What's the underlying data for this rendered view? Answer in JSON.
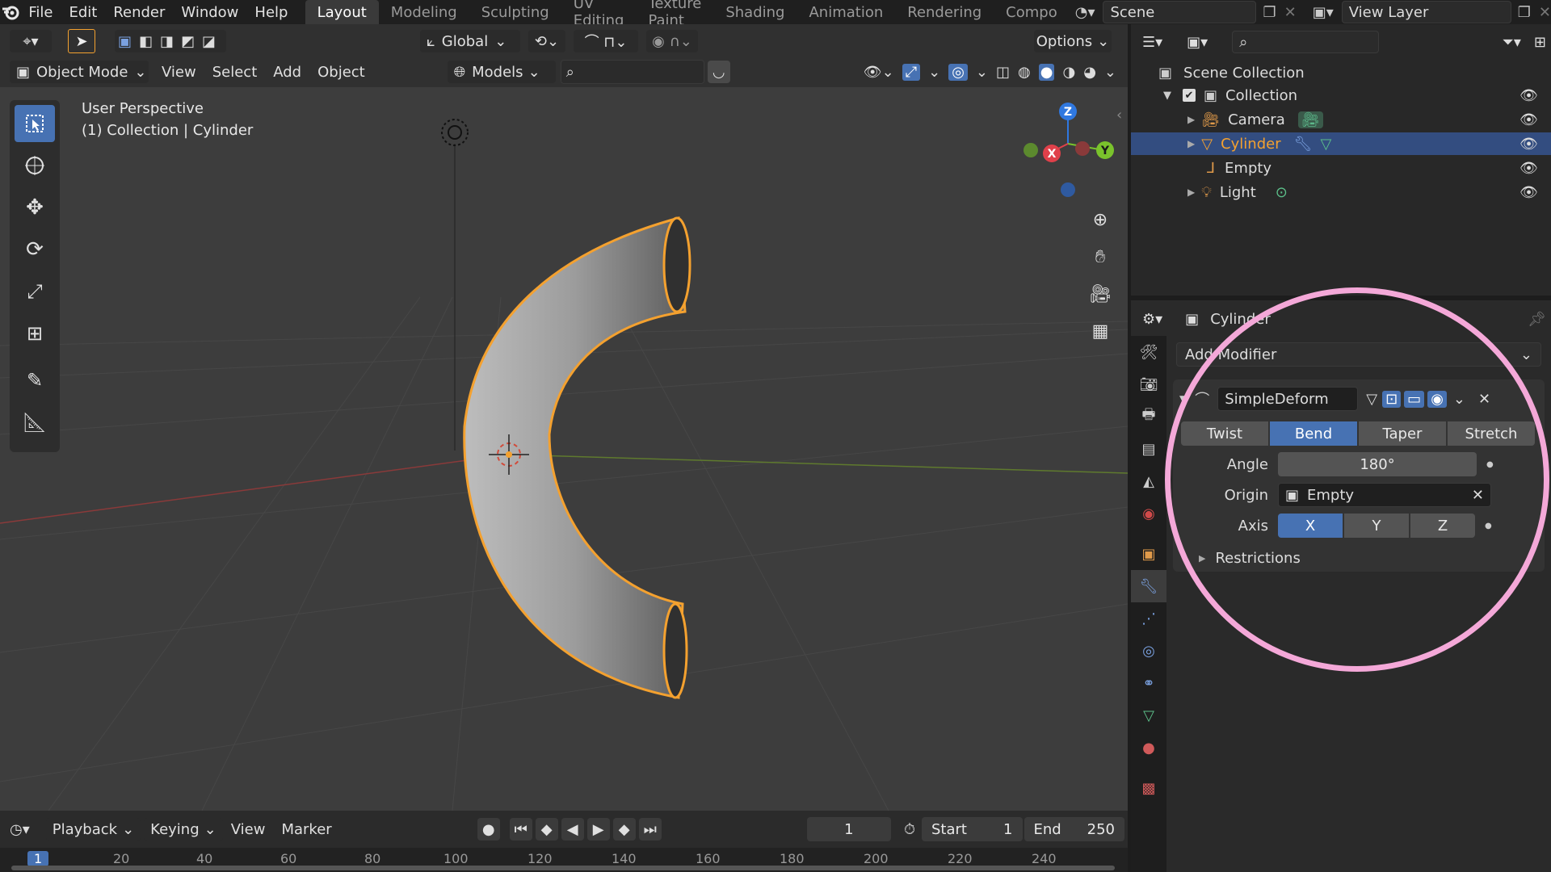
{
  "topbar": {
    "menus": [
      "File",
      "Edit",
      "Render",
      "Window",
      "Help"
    ],
    "workspaces": [
      "Layout",
      "Modeling",
      "Sculpting",
      "UV Editing",
      "Texture Paint",
      "Shading",
      "Animation",
      "Rendering",
      "Compo"
    ],
    "active_workspace": "Layout",
    "scene": "Scene",
    "view_layer": "View Layer"
  },
  "tool_header": {
    "orientation": "Global",
    "options": "Options"
  },
  "viewport_header": {
    "mode": "Object Mode",
    "menus": [
      "View",
      "Select",
      "Add",
      "Object"
    ],
    "collection_filter": "Models"
  },
  "viewport": {
    "perspective": "User Perspective",
    "context": "(1) Collection | Cylinder",
    "gizmo": {
      "x": "X",
      "y": "Y",
      "z": "Z"
    }
  },
  "outliner": {
    "root": "Scene Collection",
    "collection": "Collection",
    "items": [
      {
        "name": "Camera",
        "icon": "camera-icon",
        "selected": false
      },
      {
        "name": "Cylinder",
        "icon": "mesh-icon",
        "selected": true
      },
      {
        "name": "Empty",
        "icon": "empty-icon",
        "selected": false
      },
      {
        "name": "Light",
        "icon": "light-icon",
        "selected": false
      }
    ]
  },
  "properties": {
    "object_name": "Cylinder",
    "add_modifier": "Add Modifier",
    "modifier": {
      "name": "SimpleDeform",
      "modes": [
        "Twist",
        "Bend",
        "Taper",
        "Stretch"
      ],
      "active_mode": "Bend",
      "angle_label": "Angle",
      "angle_value": "180°",
      "origin_label": "Origin",
      "origin_value": "Empty",
      "axis_label": "Axis",
      "axes": [
        "X",
        "Y",
        "Z"
      ],
      "active_axis": "X",
      "restrictions": "Restrictions"
    }
  },
  "timeline": {
    "menus": [
      "Playback",
      "Keying",
      "View",
      "Marker"
    ],
    "current_frame": "1",
    "start_label": "Start",
    "start_value": "1",
    "end_label": "End",
    "end_value": "250",
    "ruler": [
      "1",
      "20",
      "40",
      "60",
      "80",
      "100",
      "120",
      "140",
      "160",
      "180",
      "200",
      "220",
      "240"
    ]
  },
  "colors": {
    "accent": "#4772b3",
    "selection_outline": "#f4a12f",
    "highlight_circle": "#f4a8d8"
  }
}
